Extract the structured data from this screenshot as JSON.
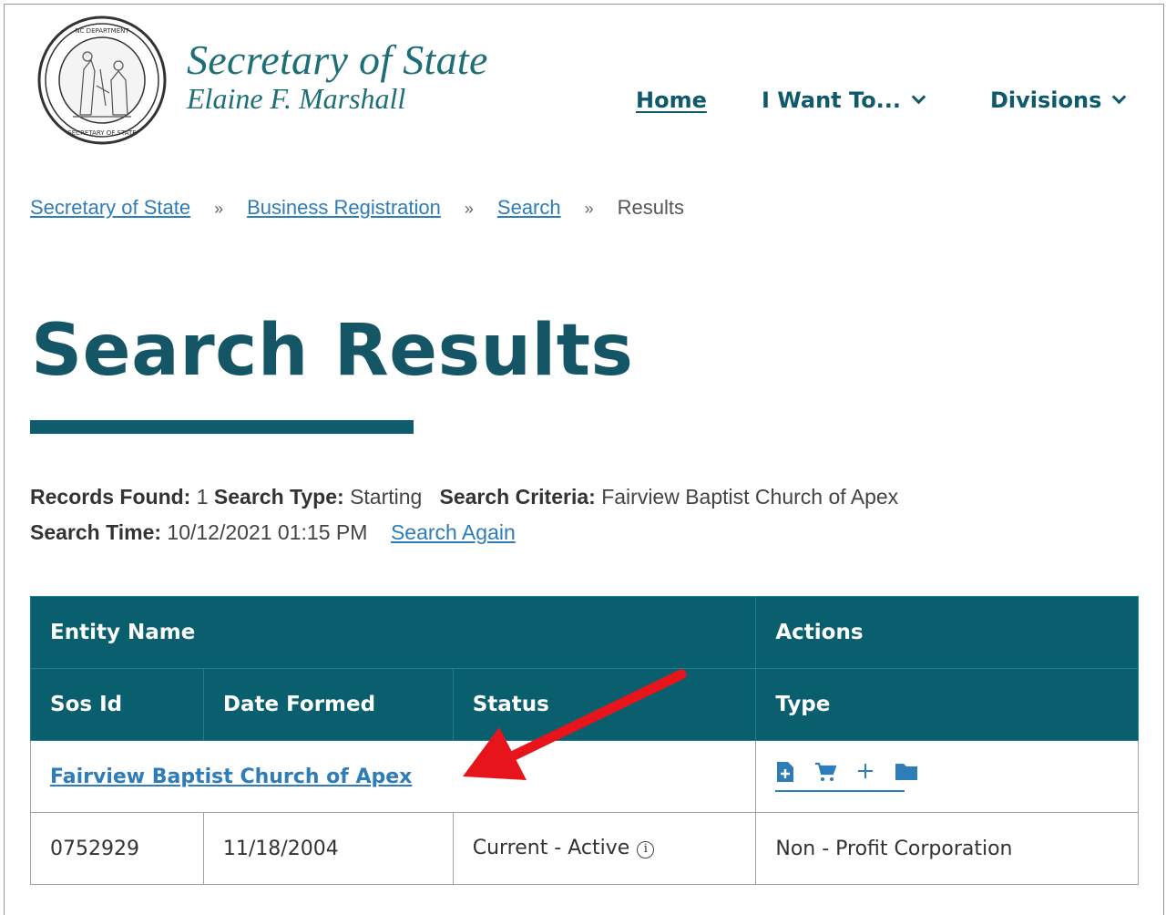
{
  "header": {
    "title": "Secretary of State",
    "subtitle": "Elaine F. Marshall",
    "nav": [
      {
        "label": "Home"
      },
      {
        "label": "I Want To..."
      },
      {
        "label": "Divisions"
      }
    ]
  },
  "breadcrumb": {
    "items": [
      "Secretary of State",
      "Business Registration",
      "Search"
    ],
    "current": "Results",
    "separator": "»"
  },
  "page_title": "Search Results",
  "meta": {
    "records_found_label": "Records Found:",
    "records_found": "1",
    "search_type_label": "Search Type:",
    "search_type": "Starting",
    "criteria_label": "Search Criteria:",
    "criteria": "Fairview Baptist Church of Apex",
    "time_label": "Search Time:",
    "time": "10/12/2021 01:15 PM",
    "search_again": "Search Again"
  },
  "table": {
    "headers_row1": [
      "Entity Name",
      "Actions"
    ],
    "headers_row2": [
      "Sos Id",
      "Date Formed",
      "Status",
      "Type"
    ],
    "rows": [
      {
        "entity_name": "Fairview Baptist Church of Apex",
        "sos_id": "0752929",
        "date_formed": "11/18/2004",
        "status": "Current - Active",
        "type": "Non - Profit Corporation"
      }
    ]
  },
  "colors": {
    "primary": "#0a5f6e",
    "link": "#2e7cb8",
    "arrow": "#e8141c"
  }
}
